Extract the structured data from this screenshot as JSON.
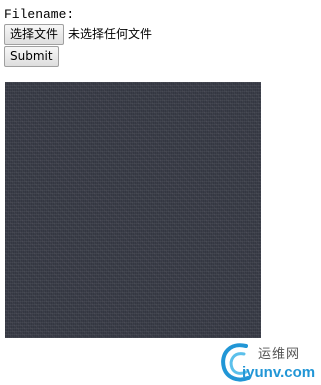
{
  "form": {
    "filename_label": "Filename:",
    "choose_file_button": "选择文件",
    "file_status": "未选择任何文件",
    "submit_button": "Submit"
  },
  "image": {
    "description_color": "#3a3d48"
  },
  "watermark": {
    "text_cn": "运维网",
    "text_en": "iyunv.com",
    "color": "#2196d6",
    "icon": "swirl-logo-icon"
  }
}
